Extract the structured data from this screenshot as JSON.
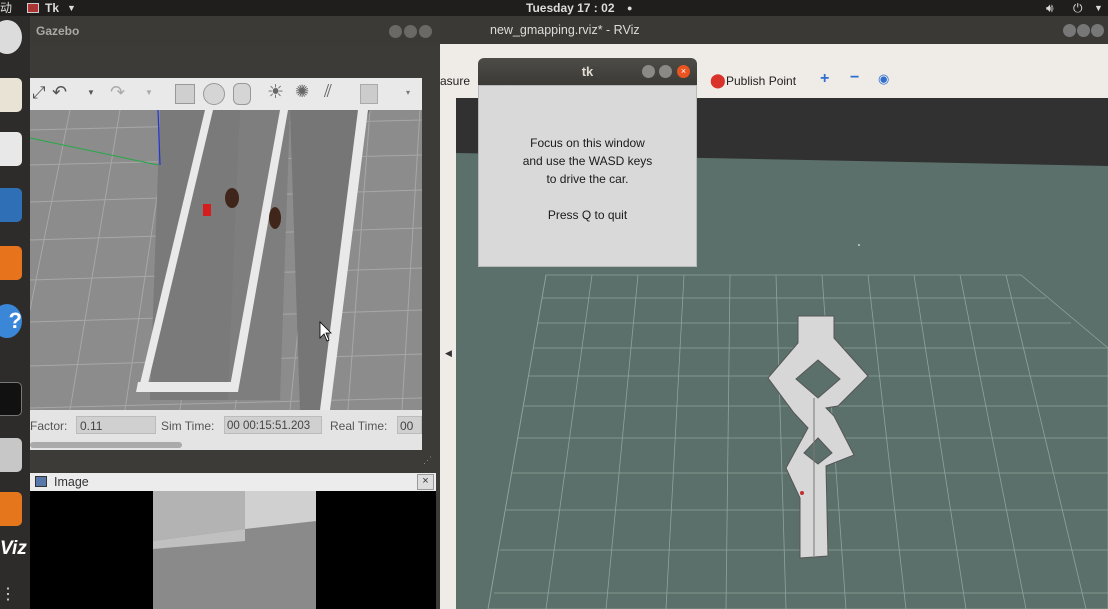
{
  "top_panel": {
    "left_partial": "动",
    "app_menu": "Tk",
    "clock": "Tuesday 17 : 02",
    "dot": "●"
  },
  "rviz": {
    "window_title": "new_gmapping.rviz* - RViz",
    "toolbar": {
      "measure_partial": "asure",
      "publish_point": "Publish Point"
    }
  },
  "gazebo": {
    "window_title": "Gazebo",
    "status": {
      "factor_label": "Factor:",
      "factor_value": "0.11",
      "sim_time_label": "Sim Time:",
      "sim_time_value": "00 00:15:51.203",
      "real_time_label": "Real Time:",
      "real_time_value": "00 0"
    }
  },
  "image_window": {
    "title": "Image",
    "close": "×"
  },
  "tk_window": {
    "title": "tk",
    "line1": "Focus on this window",
    "line2": "and use the WASD keys",
    "line3": "to drive the car.",
    "line4": "Press Q to quit"
  },
  "launcher": {
    "rviz_label": "Viz",
    "more": "⋮"
  },
  "colors": {
    "tk_close": "#e95420",
    "rviz_floor": "#5b706a",
    "map_free": "#d7d7d7"
  }
}
